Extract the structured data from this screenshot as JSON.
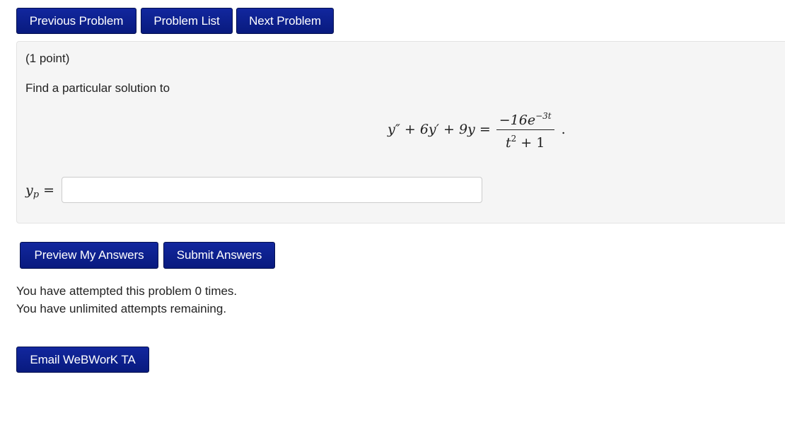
{
  "nav": {
    "previous_label": "Previous Problem",
    "list_label": "Problem List",
    "next_label": "Next Problem"
  },
  "problem": {
    "points": "(1 point)",
    "prompt": "Find a particular solution to",
    "equation": {
      "lhs": "y″ + 6y′ + 9y =",
      "numerator": "−16e",
      "numerator_exponent": "−3t",
      "denominator_base": "t",
      "denominator_exponent": "2",
      "denominator_tail": " + 1",
      "trailing": "."
    },
    "answer_label": "y",
    "answer_label_sub": "p",
    "answer_label_eq": " =",
    "answer_value": ""
  },
  "actions": {
    "preview_label": "Preview My Answers",
    "submit_label": "Submit Answers"
  },
  "status": {
    "attempts_line": "You have attempted this problem 0 times.",
    "remaining_line": "You have unlimited attempts remaining."
  },
  "footer": {
    "email_label": "Email WeBWorK TA"
  },
  "colors": {
    "button_bg": "#0c1f8c",
    "panel_bg": "#f5f5f5"
  }
}
